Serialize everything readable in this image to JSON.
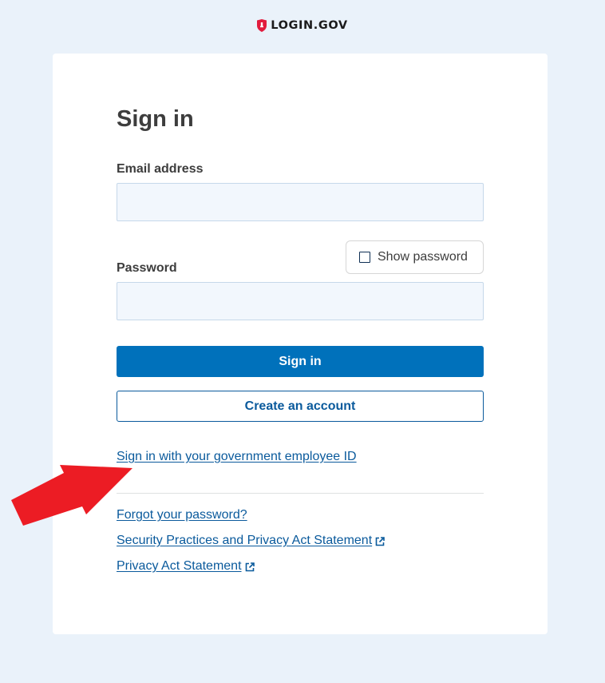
{
  "brand": {
    "name": "LOGIN.GOV"
  },
  "form": {
    "title": "Sign in",
    "email_label": "Email address",
    "email_value": "",
    "password_label": "Password",
    "password_value": "",
    "show_password_label": "Show password",
    "show_password_checked": false
  },
  "buttons": {
    "sign_in": "Sign in",
    "create_account": "Create an account"
  },
  "links": {
    "piv_cac": "Sign in with your government employee ID",
    "forgot_password": "Forgot your password?",
    "security_practices": "Security Practices and Privacy Act Statement",
    "privacy_act": "Privacy Act Statement"
  },
  "colors": {
    "background": "#eaf2fa",
    "primary": "#0071bb",
    "link": "#0a5a9c",
    "brand_red": "#e21c3d",
    "annotation_arrow": "#ec1c24"
  },
  "icons": {
    "brand": "shield-lock-icon",
    "external": "external-link-icon",
    "annotation": "red-arrow-icon"
  }
}
